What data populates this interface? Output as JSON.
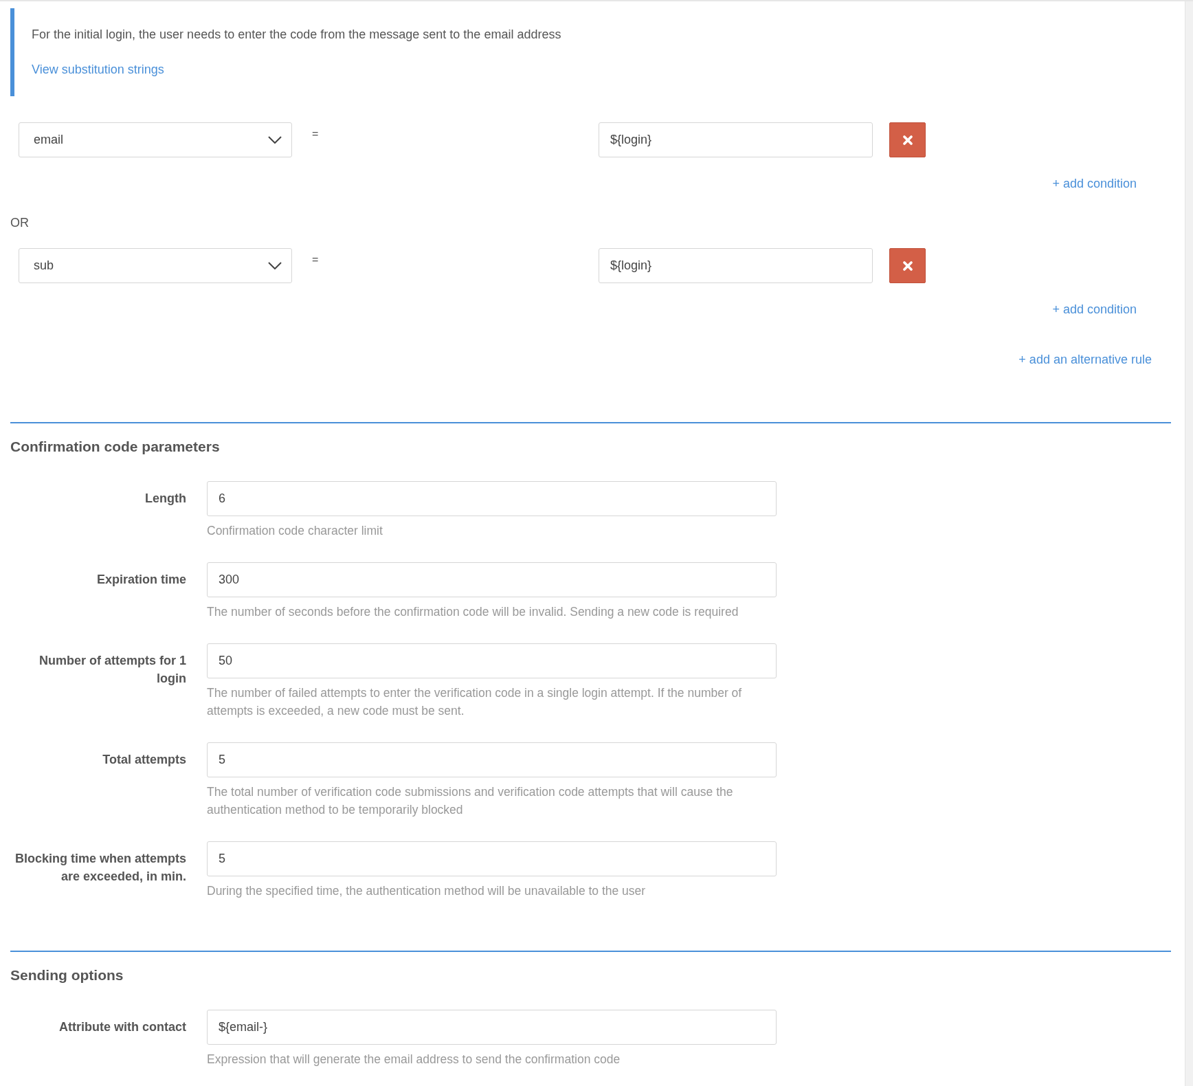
{
  "info": {
    "text": "For the initial login, the user needs to enter the code from the message sent to the email address",
    "link": "View substitution strings"
  },
  "rules": [
    {
      "field": "email",
      "operator": "=",
      "value": "${login}",
      "add_condition": "+ add condition"
    },
    {
      "joiner": "OR",
      "field": "sub",
      "operator": "=",
      "value": "${login}",
      "add_condition": "+ add condition"
    }
  ],
  "add_rule": "+ add an alternative rule",
  "sections": [
    {
      "title": "Confirmation code parameters",
      "fields": [
        {
          "label": "Length",
          "value": "6",
          "help": "Confirmation code character limit"
        },
        {
          "label": "Expiration time",
          "value": "300",
          "help": "The number of seconds before the confirmation code will be invalid. Sending a new code is required"
        },
        {
          "label": "Number of attempts for 1 login",
          "value": "50",
          "help": "The number of failed attempts to enter the verification code in a single login attempt. If the number of attempts is exceeded, a new code must be sent."
        },
        {
          "label": "Total attempts",
          "value": "5",
          "help": "The total number of verification code submissions and verification code attempts that will cause the authentication method to be temporarily blocked"
        },
        {
          "label": "Blocking time when attempts are exceeded, in min.",
          "value": "5",
          "help": "During the specified time, the authentication method will be unavailable to the user"
        }
      ]
    },
    {
      "title": "Sending options",
      "fields": [
        {
          "label": "Attribute with contact",
          "value": "${email-}",
          "help": "Expression that will generate the email address to send the confirmation code"
        }
      ]
    }
  ]
}
